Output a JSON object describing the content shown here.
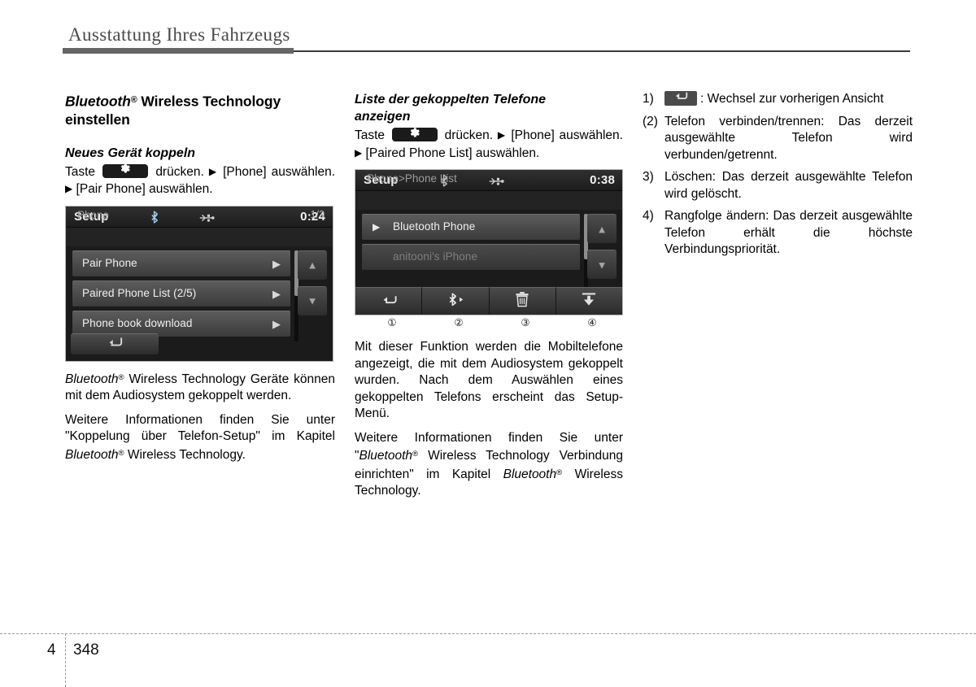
{
  "header": {
    "title": "Ausstattung Ihres Fahrzeugs"
  },
  "footer": {
    "chapter": "4",
    "page": "348"
  },
  "col1": {
    "section_title_a": "Bluetooth",
    "section_title_b": " Wireless Technology",
    "section_title_c": "einstellen",
    "sub_title": "Neues Gerät koppeln",
    "steps_lead": "Taste",
    "steps_mid": "drücken.",
    "steps_item1": "[Phone] auswählen.",
    "steps_item2": "[Pair Phone] auswählen.",
    "caption_1_pre": "Bluetooth",
    "caption_1_post": " Wireless Technology Geräte können mit dem Audiosystem gekoppelt werden.",
    "caption_2_pre": "Weitere Informationen finden Sie unter \"Koppelung über Telefon-Setup\" im Kapitel ",
    "caption_2_bt": "Bluetooth",
    "caption_2_post": " Wireless Technology."
  },
  "device1": {
    "title": "Setup",
    "clock": "0:24",
    "breadcrumb": "Phone",
    "page_indicator": "1/3",
    "bluetooth_icon": "bluetooth-icon",
    "usb_icon": "usb-icon",
    "rows": [
      {
        "label": "Pair Phone",
        "arrow": "▶"
      },
      {
        "label": "Paired Phone List  (2/5)",
        "arrow": "▶"
      },
      {
        "label": "Phone book download",
        "arrow": "▶"
      }
    ],
    "nav_up": "▲",
    "nav_down": "▼",
    "back_icon": "↩"
  },
  "col2": {
    "sub_title_line1": "Liste der gekoppelten Telefone",
    "sub_title_line2": "anzeigen",
    "steps_lead": "Taste",
    "steps_mid": "drücken.",
    "steps_item1": "[Phone] auswählen.",
    "steps_item2": "[Paired Phone List] auswählen.",
    "caption_1": "Mit dieser Funktion werden die Mobiltelefone angezeigt, die mit dem Audiosystem gekoppelt wurden. Nach dem Auswählen eines gekoppelten Telefons erscheint das Setup-Menü.",
    "caption_2_pre": "Weitere Informationen finden Sie unter \"",
    "caption_2_bt1": "Bluetooth",
    "caption_2_mid": " Wireless Technology Verbindung einrichten\" im Kapitel ",
    "caption_2_bt2": "Bluetooth",
    "caption_2_post": " Wireless Technology."
  },
  "device2": {
    "title": "Setup",
    "clock": "0:38",
    "breadcrumb": "Phone>Phone List",
    "bluetooth_icon": "bluetooth-icon",
    "usb_icon": "usb-icon",
    "rows": [
      {
        "label": "Bluetooth Phone",
        "arrow": "▶",
        "dim": false
      },
      {
        "label": "anitooni's iPhone",
        "arrow": "",
        "dim": true
      }
    ],
    "nav_up": "▲",
    "nav_down": "▼",
    "toolbar": [
      {
        "name": "back-button",
        "icon": "↩"
      },
      {
        "name": "connect-disconnect-button",
        "icon": "bluetooth-arrow-icon"
      },
      {
        "name": "delete-button",
        "icon": "trash-icon"
      },
      {
        "name": "move-to-top-button",
        "icon": "move-to-top-icon"
      }
    ],
    "callouts": [
      "①",
      "②",
      "③",
      "④"
    ]
  },
  "col3": {
    "items": [
      {
        "marker": "1)",
        "has_icon": true,
        "text": ": Wechsel zur vorherigen Ansicht"
      },
      {
        "marker": "(2)",
        "has_icon": false,
        "text": "Telefon verbinden/trennen: Das derzeit ausgewählte Telefon wird verbunden/getrennt."
      },
      {
        "marker": "3)",
        "has_icon": false,
        "text": "Löschen: Das derzeit ausgewählte Telefon wird gelöscht."
      },
      {
        "marker": "4)",
        "has_icon": false,
        "text": "Rangfolge ändern: Das derzeit ausgewählte Telefon erhält die höchste Verbindungspriorität."
      }
    ]
  }
}
